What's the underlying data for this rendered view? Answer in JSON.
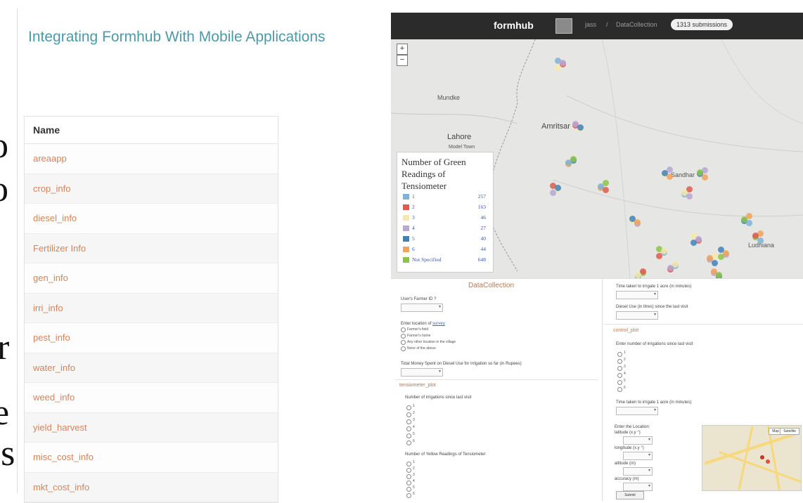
{
  "slide_fragments": [
    "o",
    "o",
    "r",
    "e",
    "es"
  ],
  "page": {
    "title": "Integrating Formhub With Mobile Applications",
    "table_header": "Name",
    "forms": [
      "areaapp",
      "crop_info",
      "diesel_info",
      "Fertilizer Info",
      "gen_info",
      "irri_info",
      "pest_info",
      "water_info",
      "weed_info",
      "yield_harvest",
      "misc_cost_info",
      "mkt_cost_info"
    ]
  },
  "screenshot": {
    "brand": "formhub",
    "crumb_user": "jass",
    "crumb_sep": "/",
    "crumb_form": "DataCollection",
    "submissions_badge": "1313 submissions",
    "zoom_in": "+",
    "zoom_out": "−",
    "map_cities": [
      "Mundke",
      "Lahore",
      "Amritsar",
      "Sandhar",
      "Ludhiana",
      "Model Town"
    ],
    "legend": {
      "title": "Number of Green Readings of Tensiometer",
      "items": [
        {
          "label": "1",
          "count": "257",
          "color": "#7fb3d5"
        },
        {
          "label": "2",
          "count": "163",
          "color": "#e05a4f"
        },
        {
          "label": "3",
          "count": "46",
          "color": "#f5e9a8"
        },
        {
          "label": "4",
          "count": "27",
          "color": "#b7a6d6"
        },
        {
          "label": "5",
          "count": "40",
          "color": "#3f82b8"
        },
        {
          "label": "6",
          "count": "44",
          "color": "#f0a35a"
        },
        {
          "label": "Not Specified",
          "count": "648",
          "color": "#8bc34a"
        }
      ]
    },
    "form": {
      "title": "DataCollection",
      "left": {
        "farmer_id_label": "User's Farmer ID ?",
        "gps_label": "Enter location of",
        "gps_link": "survey",
        "location_options": [
          "Farmer's field",
          "Farmer's home",
          "Any other location in the village",
          "None of the above"
        ],
        "diesel_money_label": "Total Money Spent on Diesel Use for Irrigation so far (in Rupees)",
        "section_tensiometer": "tensiometer_plot",
        "irrigations_label": "Number of irrigations since last visit",
        "radio_values": [
          "1",
          "2",
          "3",
          "4",
          "5",
          "6"
        ],
        "yellow_readings_label": "Number of Yellow Readings of Tensiometer"
      },
      "right": {
        "time_label": "Time taken to irrigate 1 acre (in minutes)",
        "diesel_use_label": "Diesel Use (in litres) since the last visit",
        "section_control": "control_plot",
        "control_irrigations_label": "Enter number of irrigations since last visit",
        "radio_values": [
          "1",
          "2",
          "3",
          "4",
          "5",
          "6"
        ],
        "time_label_2": "Time taken to irrigate 1 acre (in minutes)",
        "location_label": "Enter the Location:",
        "latitude_label": "latitude (x.y °)",
        "longitude_label": "longitude (x.y °)",
        "altitude_label": "altitude (m)",
        "accuracy_label": "accuracy (m)",
        "map_btn": "Map",
        "satellite_btn": "Satellite",
        "submit": "Submit"
      }
    }
  }
}
